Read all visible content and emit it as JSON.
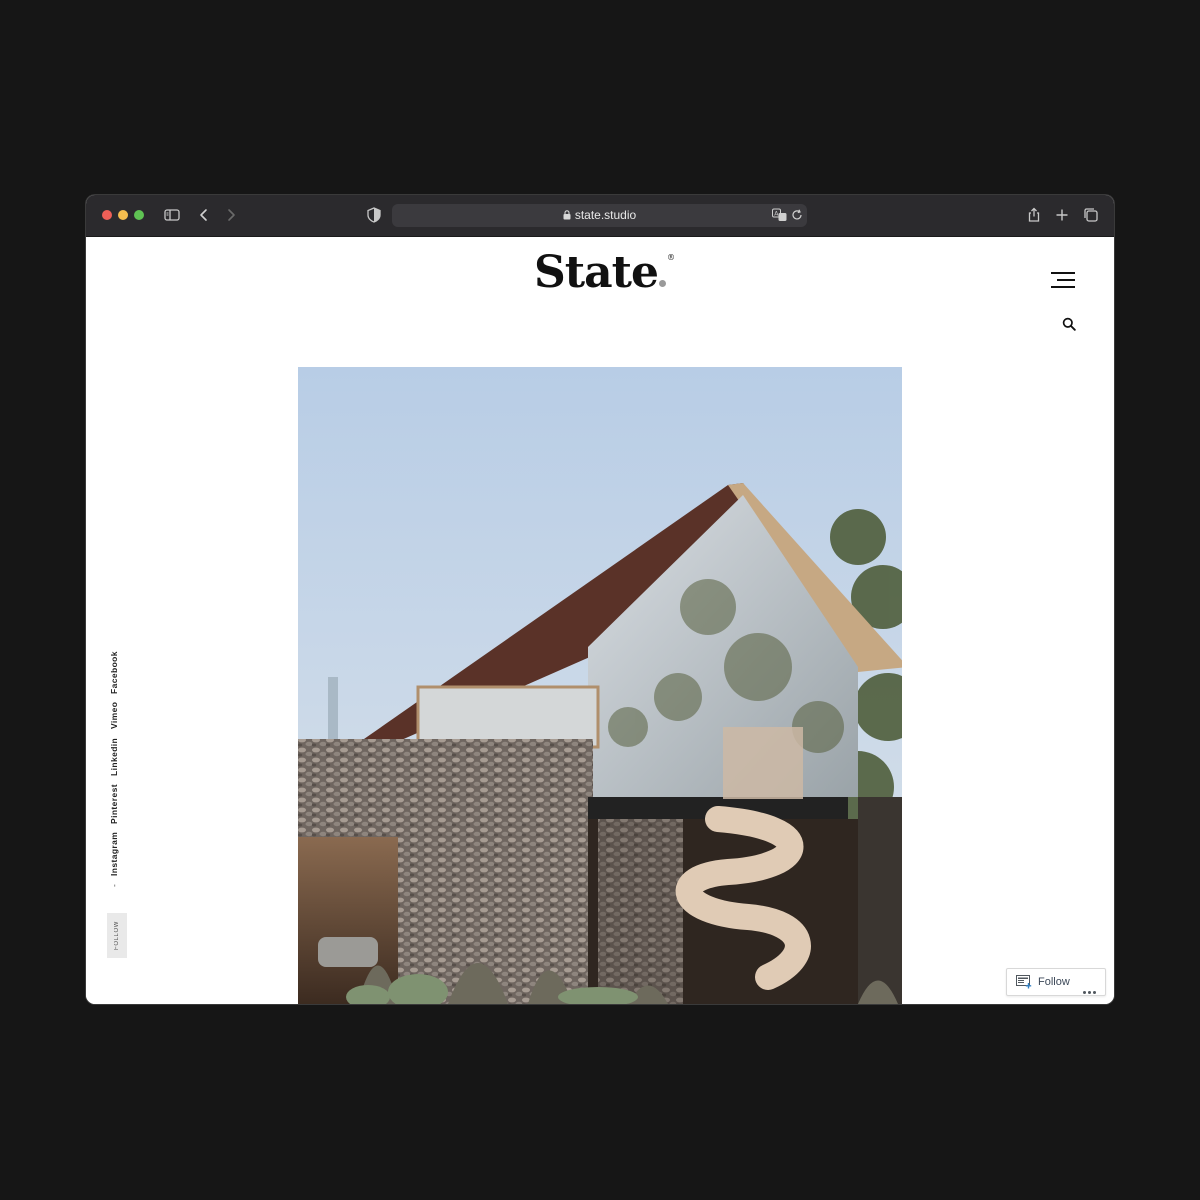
{
  "browser": {
    "url": "state.studio",
    "controls": {
      "sidebar_icon": "sidebar-icon",
      "back_icon": "chevron-left-icon",
      "forward_icon": "chevron-right-icon",
      "shield_icon": "shield-icon",
      "translate_icon": "translate-icon",
      "reload_icon": "reload-icon",
      "share_icon": "share-icon",
      "new_tab_icon": "plus-icon",
      "tabs_icon": "tabs-overview-icon"
    }
  },
  "site": {
    "logo": "State",
    "logo_mark": "®",
    "menu_icon": "hamburger-icon",
    "search_icon": "search-icon",
    "hero_alt": "Modern gabled house with stone gabion walls, glass gable facade and spiral staircase"
  },
  "social": {
    "links": [
      "Facebook",
      "Vimeo",
      "Linkedin",
      "Pinterest",
      "Instagram"
    ],
    "separator": "-",
    "follow_tab": "FOLLOW"
  },
  "follow_widget": {
    "label": "Follow",
    "more_icon": "ellipsis-icon"
  },
  "colors": {
    "page_background": "#161616",
    "toolbar": "#2b2a2d",
    "address_bar": "#3b3a3e",
    "traffic_red": "#ee5f57",
    "traffic_yellow": "#f4bd4f",
    "traffic_green": "#5fc353",
    "logo_dot": "#9a9a9a"
  }
}
